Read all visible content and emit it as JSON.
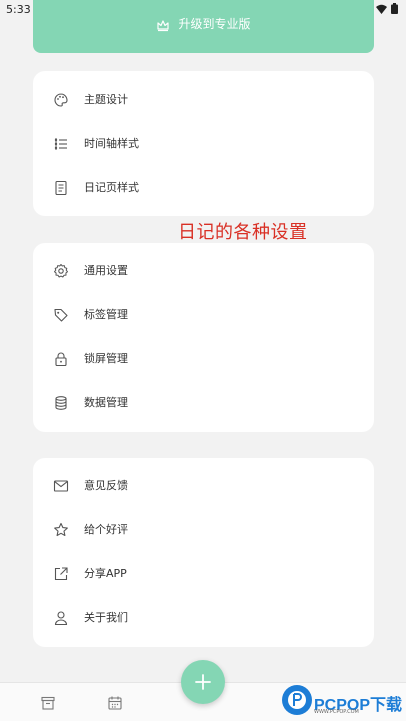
{
  "status_bar": {
    "time": "5:33"
  },
  "pro_banner": {
    "label": "升级到专业版"
  },
  "sections": [
    {
      "items": [
        {
          "label": "主题设计",
          "icon": "palette-icon"
        },
        {
          "label": "时间轴样式",
          "icon": "timeline-list-icon"
        },
        {
          "label": "日记页样式",
          "icon": "page-icon"
        }
      ]
    },
    {
      "items": [
        {
          "label": "通用设置",
          "icon": "gear-icon"
        },
        {
          "label": "标签管理",
          "icon": "tag-icon"
        },
        {
          "label": "锁屏管理",
          "icon": "lock-icon"
        },
        {
          "label": "数据管理",
          "icon": "database-icon"
        }
      ]
    },
    {
      "items": [
        {
          "label": "意见反馈",
          "icon": "mail-icon"
        },
        {
          "label": "给个好评",
          "icon": "star-icon"
        },
        {
          "label": "分享APP",
          "icon": "share-icon"
        },
        {
          "label": "关于我们",
          "icon": "person-icon"
        }
      ]
    }
  ],
  "annotation": "日记的各种设置",
  "watermark": {
    "brand": "PCPOP下载",
    "sub": "WWW.PCPOP.COM"
  },
  "colors": {
    "accent": "#84d6b4",
    "annotation": "#d93025",
    "card": "#ffffff",
    "background": "#f2f2f2"
  }
}
